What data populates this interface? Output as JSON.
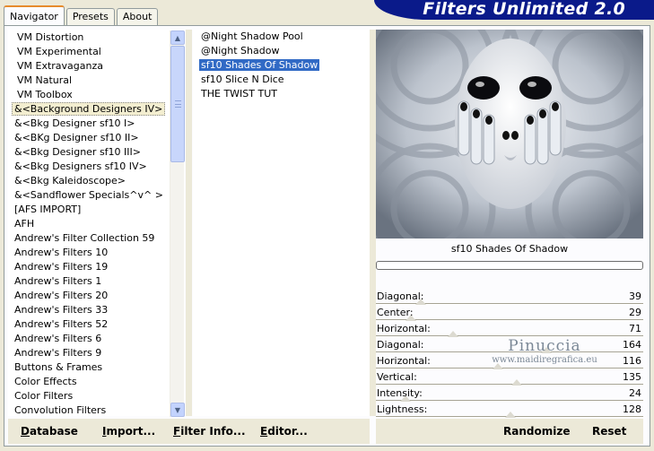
{
  "tabs": [
    {
      "label": "Navigator",
      "active": true
    },
    {
      "label": "Presets",
      "active": false
    },
    {
      "label": "About",
      "active": false
    }
  ],
  "banner_title": "Filters Unlimited 2.0",
  "category_list": [
    {
      "label": "VM Distortion",
      "indent": true
    },
    {
      "label": "VM Experimental",
      "indent": true
    },
    {
      "label": "VM Extravaganza",
      "indent": true
    },
    {
      "label": "VM Natural",
      "indent": true
    },
    {
      "label": "VM Toolbox",
      "indent": true
    },
    {
      "label": "&<Background Designers IV>",
      "indent": false,
      "current": true
    },
    {
      "label": "&<Bkg Designer sf10 I>",
      "indent": false
    },
    {
      "label": "&<BKg Designer sf10 II>",
      "indent": false
    },
    {
      "label": "&<Bkg Designer sf10 III>",
      "indent": false
    },
    {
      "label": "&<Bkg Designers sf10 IV>",
      "indent": false
    },
    {
      "label": "&<Bkg Kaleidoscope>",
      "indent": false
    },
    {
      "label": "&<Sandflower Specials^v^ >",
      "indent": false
    },
    {
      "label": "[AFS IMPORT]",
      "indent": false
    },
    {
      "label": "AFH",
      "indent": false
    },
    {
      "label": "Andrew's Filter Collection 59",
      "indent": false
    },
    {
      "label": "Andrew's Filters 10",
      "indent": false
    },
    {
      "label": "Andrew's Filters 19",
      "indent": false
    },
    {
      "label": "Andrew's Filters 1",
      "indent": false
    },
    {
      "label": "Andrew's Filters 20",
      "indent": false
    },
    {
      "label": "Andrew's Filters 33",
      "indent": false
    },
    {
      "label": "Andrew's Filters 52",
      "indent": false
    },
    {
      "label": "Andrew's Filters 6",
      "indent": false
    },
    {
      "label": "Andrew's Filters 9",
      "indent": false
    },
    {
      "label": "Buttons & Frames",
      "indent": false
    },
    {
      "label": "Color Effects",
      "indent": false
    },
    {
      "label": "Color Filters",
      "indent": false
    },
    {
      "label": "Convolution Filters",
      "indent": false
    }
  ],
  "filter_list": [
    {
      "label": "@Night Shadow Pool",
      "selected": false
    },
    {
      "label": "@Night Shadow",
      "selected": false
    },
    {
      "label": "sf10 Shades Of Shadow",
      "selected": true
    },
    {
      "label": "sf10 Slice N Dice",
      "selected": false
    },
    {
      "label": "THE TWIST TUT",
      "selected": false
    }
  ],
  "selected_filter_name": "sf10 Shades Of Shadow",
  "progress": 0,
  "parameters": [
    {
      "label": "Diagonal:",
      "value": "39",
      "level": 39
    },
    {
      "label": "Center:",
      "value": "29",
      "level": 29
    },
    {
      "label": "Horizontal:",
      "value": "71",
      "level": 71
    },
    {
      "label": "Diagonal:",
      "value": "164",
      "level": 164
    },
    {
      "label": "Horizontal:",
      "value": "116",
      "level": 116
    },
    {
      "label": "Vertical:",
      "value": "135",
      "level": 135
    },
    {
      "label": "Intensity:",
      "value": "24",
      "level": 24
    },
    {
      "label": "Lightness:",
      "value": "128",
      "level": 128
    }
  ],
  "param_max": 255,
  "buttons_left": [
    {
      "label": "Database",
      "underline": "D"
    },
    {
      "label": "Import...",
      "underline": "I"
    },
    {
      "label": "Filter Info...",
      "underline": "F"
    },
    {
      "label": "Editor...",
      "underline": "E"
    }
  ],
  "buttons_right": {
    "randomize": "Randomize",
    "reset": "Reset"
  },
  "watermark": {
    "name": "Pinuccia",
    "url": "www.maidiregrafica.eu"
  },
  "colors": {
    "selection": "#316ac5",
    "banner": "#0a1a8a",
    "face": "#ece9d8"
  }
}
